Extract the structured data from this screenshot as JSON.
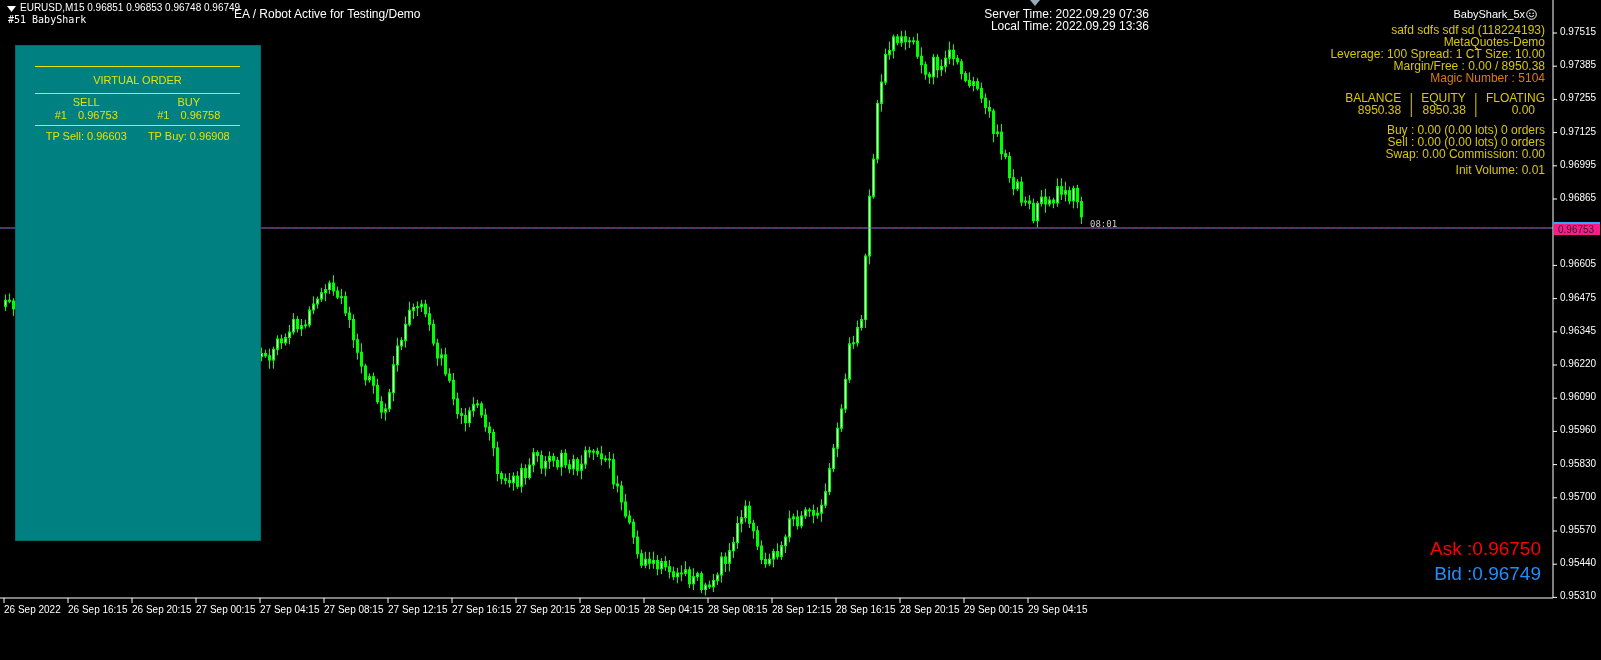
{
  "header": {
    "quote": "EURUSD,M15  0.96851 0.96853 0.96748 0.96749",
    "expert": "#51 BabyShark",
    "comment": "EA / Robot Active for Testing/Demo"
  },
  "times": [
    "Server Time: 2022.09.29 07:36",
    "Local Time: 2022.09.29 13:36"
  ],
  "expert_label": "BabyShark_5x",
  "account_lines": [
    {
      "text": "safd    sdfs sdf  sd (118224193)",
      "kind": "info"
    },
    {
      "text": "MetaQuotes-Demo",
      "kind": "info"
    },
    {
      "text": "Leverage: 100 Spread: 1 CT Size: 10.00",
      "kind": "info"
    },
    {
      "text": "Margin/Free : 0.00 / 8950.38",
      "kind": "info"
    },
    {
      "text": "Magic Number : 5104",
      "kind": "magic"
    }
  ],
  "summary": [
    {
      "label": "BALANCE",
      "value": "8950.38",
      "separators": [
        "|",
        "|"
      ]
    },
    {
      "label": "EQUITY",
      "value": "8950.38",
      "separators": [
        "|",
        "|"
      ]
    },
    {
      "label": "FLOATING",
      "value": "0.00"
    }
  ],
  "order_lines": [
    "Buy : 0.00 (0.00 lots) 0 orders",
    "Sell : 0.00 (0.00 lots) 0 orders",
    "Swap: 0.00 Commission: 0.00"
  ],
  "init_volume": "Init Volume: 0.01",
  "virtual_order": {
    "title": "VIRTUAL ORDER",
    "sides": [
      {
        "label": "SELL",
        "ticket": "#1",
        "price": "0.96753",
        "tp": "TP Sell: 0.96603"
      },
      {
        "label": "BUY",
        "ticket": "#1",
        "price": "0.96758",
        "tp": "TP Buy: 0.96908"
      }
    ]
  },
  "ask": "Ask :0.96750",
  "bid": "Bid :0.96749",
  "countdown": "08:01",
  "current_price": "0.96753",
  "price_ticks": [
    "0.97515",
    "0.97385",
    "0.97255",
    "0.97125",
    "0.96995",
    "0.96865",
    "0.96605",
    "0.96475",
    "0.96345",
    "0.96220",
    "0.96090",
    "0.95960",
    "0.95830",
    "0.95700",
    "0.95570",
    "0.95440",
    "0.95310"
  ],
  "time_ticks": [
    "26 Sep 2022",
    "26 Sep 16:15",
    "26 Sep 20:15",
    "27 Sep 00:15",
    "27 Sep 04:15",
    "27 Sep 08:15",
    "27 Sep 12:15",
    "27 Sep 16:15",
    "27 Sep 20:15",
    "28 Sep 00:15",
    "28 Sep 04:15",
    "28 Sep 08:15",
    "28 Sep 12:15",
    "28 Sep 16:15",
    "28 Sep 20:15",
    "29 Sep 00:15",
    "29 Sep 04:15"
  ]
}
